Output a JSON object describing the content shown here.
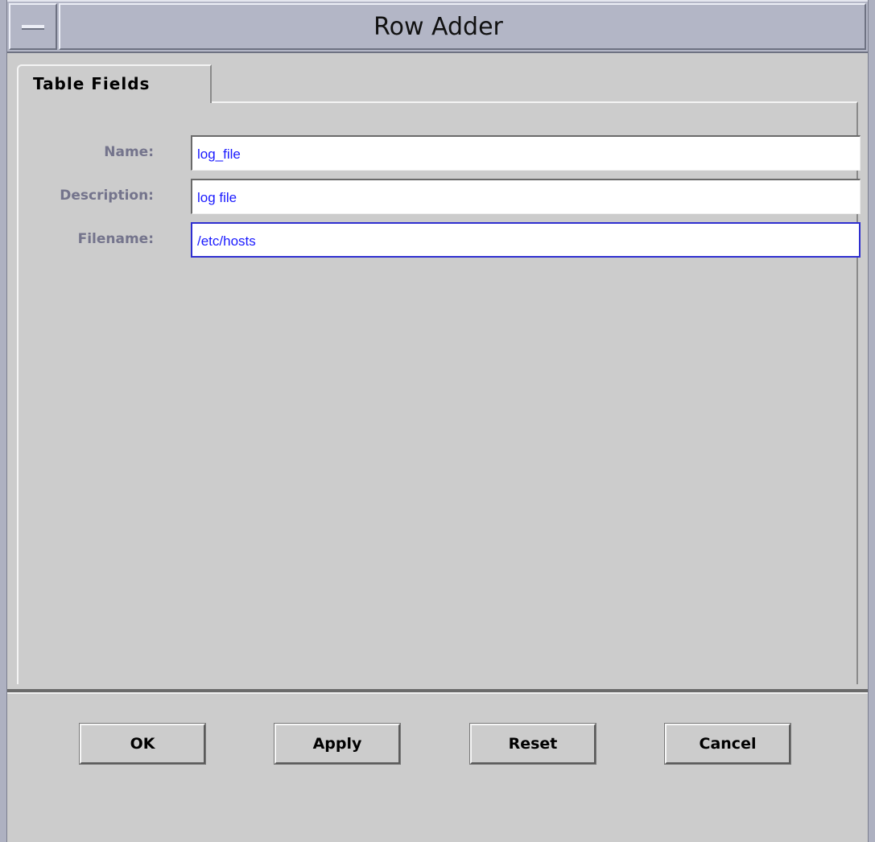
{
  "window": {
    "title": "Row Adder"
  },
  "tabs": [
    {
      "label": "Table Fields",
      "selected": true
    }
  ],
  "fields": [
    {
      "label": "Name:",
      "value": "log_file"
    },
    {
      "label": "Description:",
      "value": "log file"
    },
    {
      "label": "Filename:",
      "value": "/etc/hosts",
      "focused": true
    }
  ],
  "buttons": {
    "ok": "OK",
    "apply": "Apply",
    "reset": "Reset",
    "cancel": "Cancel"
  },
  "colors": {
    "label_text": "#74748c",
    "input_text": "#1a1aff",
    "focus_border": "#2f2fd0",
    "panel_bg": "#cccccc",
    "titlebar_bg": "#b3b6c6"
  }
}
